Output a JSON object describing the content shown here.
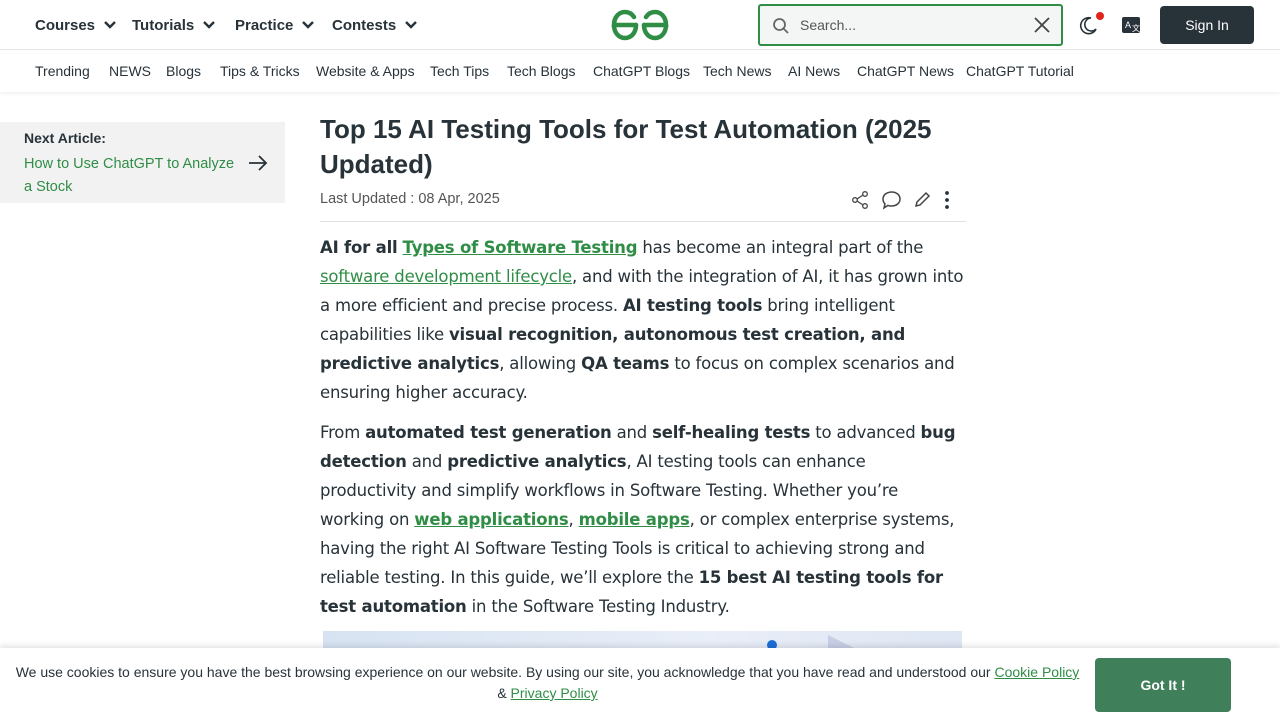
{
  "header": {
    "menus": [
      {
        "label": "Courses"
      },
      {
        "label": "Tutorials"
      },
      {
        "label": "Practice"
      },
      {
        "label": "Contests"
      }
    ],
    "search_placeholder": "Search...",
    "signin_label": "Sign In",
    "logo_icon": "gfg-logo-icon",
    "brand_color": "#2f8d46"
  },
  "subnav": {
    "items": [
      "Trending",
      "NEWS",
      "Blogs",
      "Tips & Tricks",
      "Website & Apps",
      "Tech Tips",
      "Tech Blogs",
      "ChatGPT Blogs",
      "Tech News",
      "AI News",
      "ChatGPT News",
      "ChatGPT Tutorial"
    ]
  },
  "next_article": {
    "heading": "Next Article:",
    "link": "How to Use ChatGPT to Analyze a Stock"
  },
  "article": {
    "title": "Top 15 AI Testing Tools for Test Automation (2025 Updated)",
    "updated": "Last Updated : 08 Apr, 2025",
    "p1": {
      "b1": "AI for all",
      "l1": "Types of Software Testing",
      "t1": " has become an integral part of the ",
      "l2": "software development lifecycle",
      "t2": ", and with the integration of AI, it has grown into a more efficient and precise process. ",
      "b2": "AI testing tools",
      "t3": " bring intelligent capabilities like ",
      "b3": "visual recognition, autonomous test creation, and predictive analytics",
      "t4": ", allowing ",
      "b4": "QA teams",
      "t5": " to focus on complex scenarios and ensuring higher accuracy."
    },
    "p2": {
      "t0": "From ",
      "b1": "automated test generation",
      "t1": " and ",
      "b2": "self-healing tests",
      "t2": " to advanced ",
      "b3": "bug detection",
      "t3": " and ",
      "b4": "predictive analytics",
      "t4": ", AI testing tools can enhance productivity and simplify workflows in Software Testing. Whether you’re working on ",
      "l1": "web applications",
      "t5": ", ",
      "l2": "mobile apps",
      "t6": ", or complex enterprise systems, having the right AI Software Testing Tools is critical to achieving strong and reliable testing. In this guide, we’ll explore the ",
      "b5": "15 best AI testing tools for test automation",
      "t7": " in the Software Testing Industry."
    }
  },
  "cookie": {
    "text": "We use cookies to ensure you have the best browsing experience on our website. By using our site, you acknowledge that you have read and understood our ",
    "link1": "Cookie Policy",
    "amp": " & ",
    "link2": "Privacy Policy",
    "button": "Got It !"
  }
}
